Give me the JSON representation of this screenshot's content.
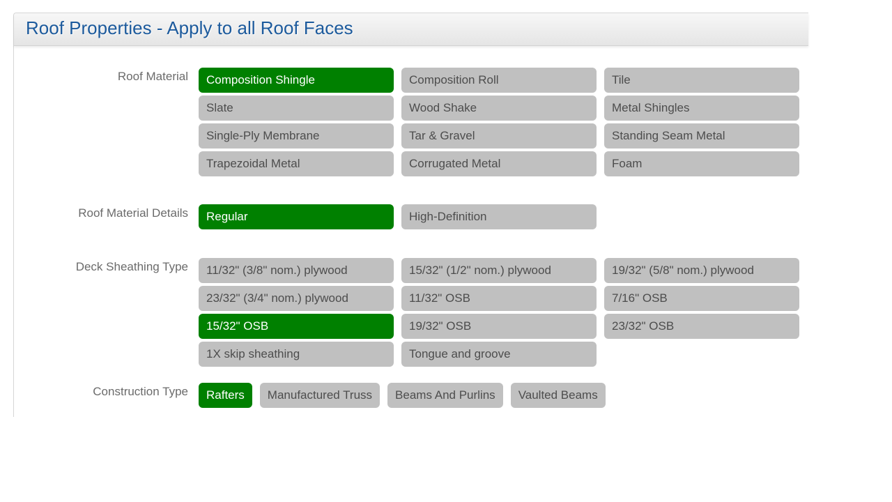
{
  "title": "Roof Properties - Apply to all Roof Faces",
  "colors": {
    "selected": "#008000",
    "unselected": "#c0c0c0",
    "title": "#1c5a9c"
  },
  "roof_material": {
    "label": "Roof Material",
    "options": [
      {
        "label": "Composition Shingle",
        "selected": true
      },
      {
        "label": "Composition Roll",
        "selected": false
      },
      {
        "label": "Tile",
        "selected": false
      },
      {
        "label": "Slate",
        "selected": false
      },
      {
        "label": "Wood Shake",
        "selected": false
      },
      {
        "label": "Metal Shingles",
        "selected": false
      },
      {
        "label": "Single-Ply Membrane",
        "selected": false
      },
      {
        "label": "Tar & Gravel",
        "selected": false
      },
      {
        "label": "Standing Seam Metal",
        "selected": false
      },
      {
        "label": "Trapezoidal Metal",
        "selected": false
      },
      {
        "label": "Corrugated Metal",
        "selected": false
      },
      {
        "label": "Foam",
        "selected": false
      }
    ]
  },
  "roof_material_details": {
    "label": "Roof Material Details",
    "options": [
      {
        "label": "Regular",
        "selected": true
      },
      {
        "label": "High-Definition",
        "selected": false
      }
    ]
  },
  "deck_sheathing": {
    "label": "Deck Sheathing Type",
    "options": [
      {
        "label": "11/32\" (3/8\" nom.) plywood",
        "selected": false
      },
      {
        "label": "15/32\" (1/2\" nom.) plywood",
        "selected": false
      },
      {
        "label": "19/32\" (5/8\" nom.) plywood",
        "selected": false
      },
      {
        "label": "23/32\" (3/4\" nom.) plywood",
        "selected": false
      },
      {
        "label": "11/32\" OSB",
        "selected": false
      },
      {
        "label": "7/16\" OSB",
        "selected": false
      },
      {
        "label": "15/32\" OSB",
        "selected": true
      },
      {
        "label": "19/32\" OSB",
        "selected": false
      },
      {
        "label": "23/32\" OSB",
        "selected": false
      },
      {
        "label": "1X skip sheathing",
        "selected": false
      },
      {
        "label": "Tongue and groove",
        "selected": false
      }
    ]
  },
  "construction_type": {
    "label": "Construction Type",
    "options": [
      {
        "label": "Rafters",
        "selected": true
      },
      {
        "label": "Manufactured Truss",
        "selected": false
      },
      {
        "label": "Beams And Purlins",
        "selected": false
      },
      {
        "label": "Vaulted Beams",
        "selected": false
      }
    ]
  }
}
